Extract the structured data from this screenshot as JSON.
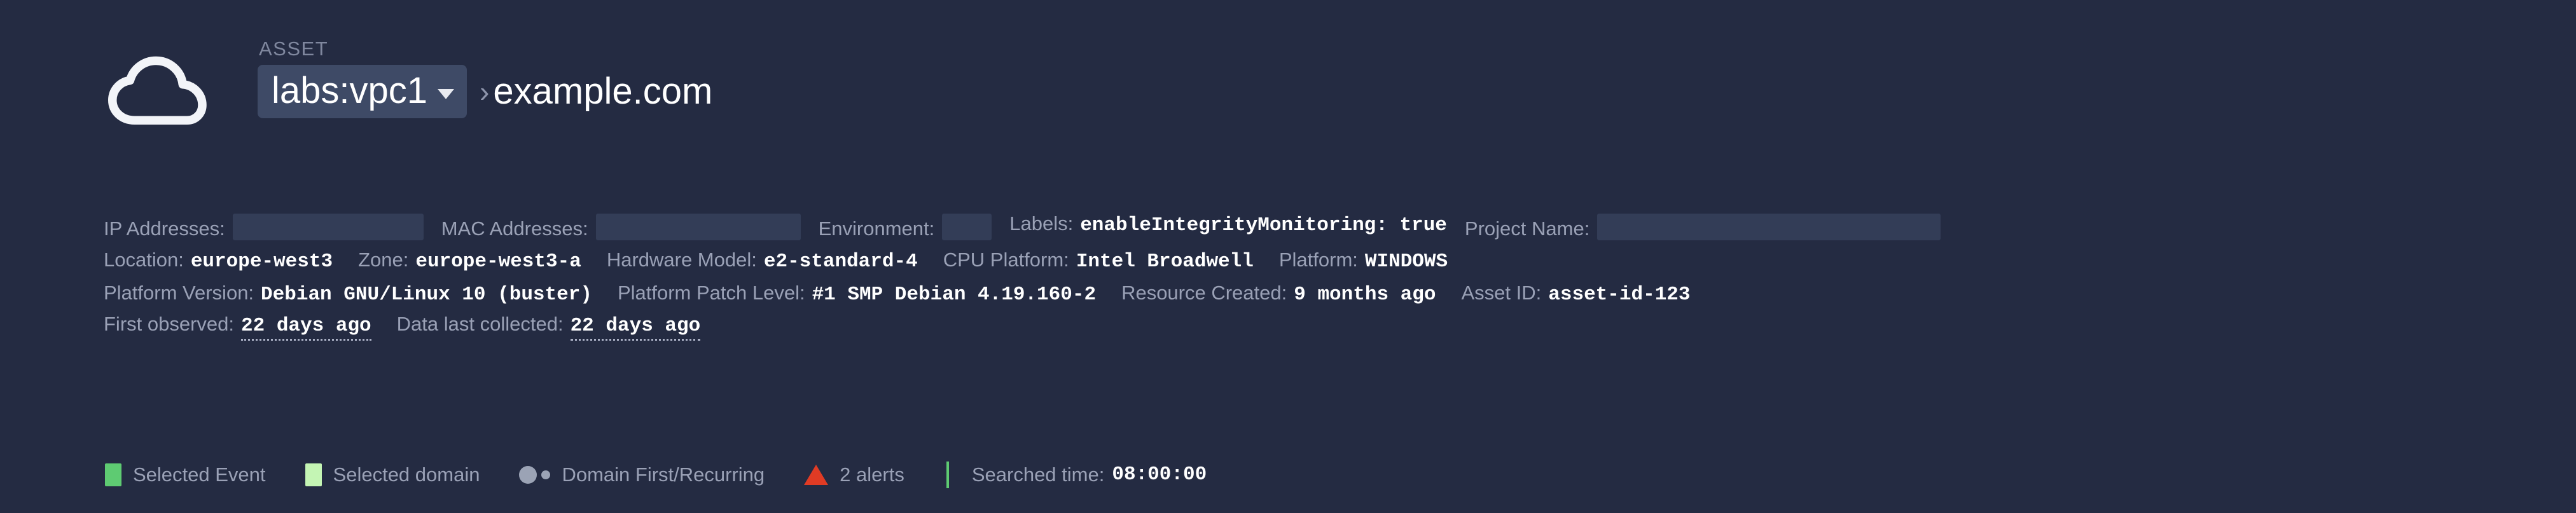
{
  "theme": {
    "background": "#242b42",
    "pill_background": "#3e4a66",
    "label_color": "#9aa1b6",
    "value_color": "#ffffff",
    "redact_color": "#333d57",
    "accent_green": "#5ecb72",
    "accent_light_green": "#c4f5b4",
    "accent_red": "#e03b24",
    "dot_gray": "#9ba3b5"
  },
  "header": {
    "logo_icon": "cloud-icon",
    "kicker": "ASSET",
    "scope": {
      "label": "labs:vpc1",
      "caret_icon": "chevron-down-icon"
    },
    "breadcrumb_separator": "›",
    "host": "example.com"
  },
  "meta": {
    "row1": [
      {
        "label": "IP Addresses:",
        "value": "",
        "redacted": true,
        "name": "ip-addresses"
      },
      {
        "label": "MAC Addresses:",
        "value": "",
        "redacted": true,
        "name": "mac-addresses"
      },
      {
        "label": "Environment:",
        "value": "",
        "redacted": true,
        "name": "environment"
      },
      {
        "label": "Labels:",
        "value": "enableIntegrityMonitoring: true",
        "redacted": false,
        "name": "labels"
      },
      {
        "label": "Project Name:",
        "value": "",
        "redacted": true,
        "name": "project-name"
      }
    ],
    "row2": [
      {
        "label": "Location:",
        "value": "europe-west3",
        "name": "location"
      },
      {
        "label": "Zone:",
        "value": "europe-west3-a",
        "name": "zone"
      },
      {
        "label": "Hardware Model:",
        "value": "e2-standard-4",
        "name": "hardware-model"
      },
      {
        "label": "CPU Platform:",
        "value": "Intel Broadwell",
        "name": "cpu-platform"
      },
      {
        "label": "Platform:",
        "value": "WINDOWS",
        "name": "platform"
      }
    ],
    "row3": [
      {
        "label": "Platform Version:",
        "value": "Debian GNU/Linux 10 (buster)",
        "name": "platform-version"
      },
      {
        "label": "Platform Patch Level:",
        "value": "#1 SMP Debian 4.19.160-2",
        "name": "platform-patch-level"
      },
      {
        "label": "Resource Created:",
        "value": "9 months ago",
        "name": "resource-created"
      },
      {
        "label": "Asset ID:",
        "value": "asset-id-123",
        "name": "asset-id"
      }
    ],
    "row4": [
      {
        "label": "First observed:",
        "value": "22 days ago",
        "name": "first-observed"
      },
      {
        "label": "Data last collected:",
        "value": "22 days ago",
        "name": "data-last-collected"
      }
    ]
  },
  "legend": {
    "items": [
      {
        "type": "swatch",
        "color": "#5ecb72",
        "label": "Selected Event",
        "name": "legend-selected-event"
      },
      {
        "type": "swatch",
        "color": "#c4f5b4",
        "label": "Selected domain",
        "name": "legend-selected-domain"
      },
      {
        "type": "dots",
        "color": "#9ba3b5",
        "label": "Domain First/Recurring",
        "name": "legend-domain-first-recurring"
      },
      {
        "type": "triangle",
        "color": "#e03b24",
        "label": "2 alerts",
        "name": "legend-alerts"
      }
    ],
    "divider_color": "#5ecb72",
    "searched_time_label": "Searched time:",
    "searched_time_value": "08:00:00"
  }
}
